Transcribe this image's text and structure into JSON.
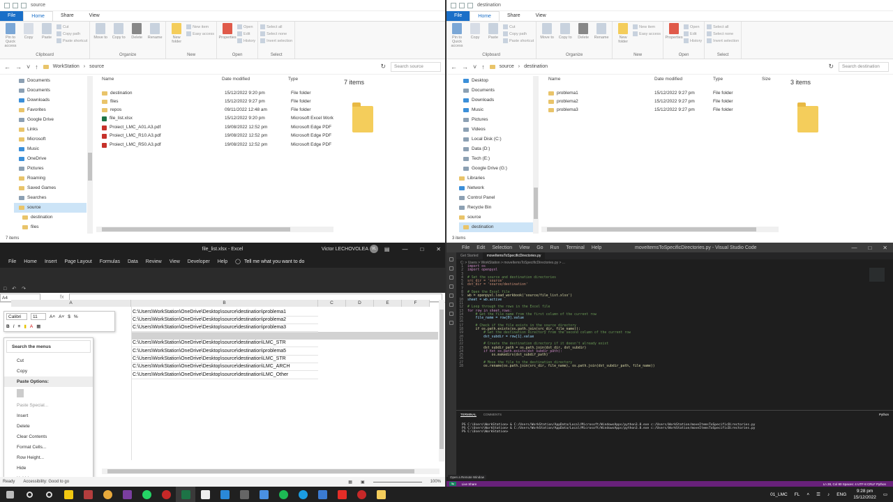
{
  "left_explorer": {
    "title": "source",
    "tabs": [
      "File",
      "Home",
      "Share",
      "View"
    ],
    "ribbon": {
      "clipboard": {
        "pin": "Pin to Quick access",
        "copy": "Copy",
        "paste": "Paste",
        "cut": "Cut",
        "copy_path": "Copy path",
        "paste_shortcut": "Paste shortcut",
        "label": "Clipboard"
      },
      "organize": {
        "move_to": "Move to",
        "copy_to": "Copy to",
        "delete": "Delete",
        "rename": "Rename",
        "label": "Organize"
      },
      "new": {
        "new_folder": "New folder",
        "new_item": "New item",
        "easy_access": "Easy access",
        "label": "New"
      },
      "open": {
        "properties": "Properties",
        "open": "Open",
        "edit": "Edit",
        "history": "History",
        "label": "Open"
      },
      "select": {
        "select_all": "Select all",
        "select_none": "Select none",
        "invert": "Invert selection",
        "label": "Select"
      }
    },
    "path": [
      "WorkStation",
      "source"
    ],
    "search_placeholder": "Search source",
    "nav_items": [
      "Documents",
      "Documents",
      "Downloads",
      "Favorites",
      "Google Drive",
      "Links",
      "Microsoft",
      "Music",
      "OneDrive",
      "Pictures",
      "Roaming",
      "Saved Games",
      "Searches",
      "source",
      "destination",
      "files"
    ],
    "columns": {
      "name": "Name",
      "date": "Date modified",
      "type": "Type"
    },
    "files": [
      {
        "name": "destination",
        "date": "15/12/2022 9:20 pm",
        "type": "File folder",
        "icon": "folder"
      },
      {
        "name": "files",
        "date": "15/12/2022 9:27 pm",
        "type": "File folder",
        "icon": "folder"
      },
      {
        "name": "repos",
        "date": "09/11/2022 12:48 am",
        "type": "File folder",
        "icon": "folder"
      },
      {
        "name": "file_list.xlsx",
        "date": "15/12/2022 9:20 pm",
        "type": "Microsoft Excel Work",
        "icon": "excel"
      },
      {
        "name": "Proiect_LMC_A01.A3.pdf",
        "date": "19/08/2022 12:52 pm",
        "type": "Microsoft Edge PDF",
        "icon": "pdf"
      },
      {
        "name": "Proiect_LMC_R10.A3.pdf",
        "date": "19/08/2022 12:52 pm",
        "type": "Microsoft Edge PDF",
        "icon": "pdf"
      },
      {
        "name": "Proiect_LMC_R50.A3.pdf",
        "date": "19/08/2022 12:52 pm",
        "type": "Microsoft Edge PDF",
        "icon": "pdf"
      }
    ],
    "preview_count": "7 items",
    "status": "7 items"
  },
  "right_explorer": {
    "title": "destination",
    "tabs": [
      "File",
      "Home",
      "Share",
      "View"
    ],
    "ribbon": {
      "clipboard": {
        "pin": "Pin to Quick access",
        "copy": "Copy",
        "paste": "Paste",
        "cut": "Cut",
        "copy_path": "Copy path",
        "paste_shortcut": "Paste shortcut",
        "label": "Clipboard"
      },
      "organize": {
        "move_to": "Move to",
        "copy_to": "Copy to",
        "delete": "Delete",
        "rename": "Rename",
        "label": "Organize"
      },
      "new": {
        "new_folder": "New folder",
        "new_item": "New item",
        "easy_access": "Easy access",
        "label": "New"
      },
      "open": {
        "properties": "Properties",
        "open": "Open",
        "edit": "Edit",
        "history": "History",
        "label": "Open"
      },
      "select": {
        "select_all": "Select all",
        "select_none": "Select none",
        "invert": "Invert selection",
        "label": "Select"
      }
    },
    "path": [
      "source",
      "destination"
    ],
    "search_placeholder": "Search destination",
    "nav_items": [
      "Desktop",
      "Documents",
      "Downloads",
      "Music",
      "Pictures",
      "Videos",
      "Local Disk (C:)",
      "Data (D:)",
      "Tech (E:)",
      "Google Drive (G:)",
      "Libraries",
      "Network",
      "Control Panel",
      "Recycle Bin",
      "source",
      "destination"
    ],
    "columns": {
      "name": "Name",
      "date": "Date modified",
      "type": "Type",
      "size": "Size"
    },
    "files": [
      {
        "name": "problema1",
        "date": "15/12/2022 9:27 pm",
        "type": "File folder"
      },
      {
        "name": "problema2",
        "date": "15/12/2022 9:27 pm",
        "type": "File folder"
      },
      {
        "name": "problema3",
        "date": "15/12/2022 9:27 pm",
        "type": "File folder"
      }
    ],
    "preview_count": "3 items",
    "status": "3 items"
  },
  "excel": {
    "title": "file_list.xlsx  -  Excel",
    "user": "Victor LECHOVOLEA",
    "user_initials": "VL",
    "menu": [
      "File",
      "Home",
      "Insert",
      "Page Layout",
      "Formulas",
      "Data",
      "Review",
      "View",
      "Developer",
      "Help"
    ],
    "tell_me": "Tell me what you want to do",
    "name_box": "A4",
    "fx": "fx",
    "columns": [
      "A",
      "B",
      "C",
      "D",
      "E",
      "F"
    ],
    "col_b_values": [
      "C:\\Users\\WorkStation\\OneDrive\\Desktop\\source\\destination\\problema1",
      "C:\\Users\\WorkStation\\OneDrive\\Desktop\\source\\destination\\problema2",
      "C:\\Users\\WorkStation\\OneDrive\\Desktop\\source\\destination\\problema3",
      "",
      "C:\\Users\\WorkStation\\OneDrive\\Desktop\\source\\destination\\LMC_STR",
      "C:\\Users\\WorkStation\\OneDrive\\Desktop\\source\\destination\\problema5",
      "C:\\Users\\WorkStation\\OneDrive\\Desktop\\source\\destination\\LMC_STR",
      "C:\\Users\\WorkStation\\OneDrive\\Desktop\\source\\destination\\LMC_ARCH",
      "C:\\Users\\WorkStation\\OneDrive\\Desktop\\source\\destination\\LMC_Other"
    ],
    "mini_toolbar": {
      "font": "Calibri",
      "size": "11"
    },
    "context_menu": {
      "search": "Search the menus",
      "items": [
        "Cut",
        "Copy",
        "Paste Options:",
        "",
        "Paste Special...",
        "Insert",
        "Delete",
        "Clear Contents",
        "Format Cells...",
        "Row Height...",
        "Hide",
        "Unhide"
      ]
    },
    "status": {
      "ready": "Ready",
      "accessibility": "Accessibility: Good to go",
      "zoom": "100%"
    }
  },
  "vscode": {
    "menu": [
      "File",
      "Edit",
      "Selection",
      "View",
      "Go",
      "Run",
      "Terminal",
      "Help"
    ],
    "title": "moveItemsToSpecificDirectories.py - Visual Studio Code",
    "tabs": [
      "Get Started",
      "moveItemsToSpecificDirectories.py"
    ],
    "breadcrumb": "C: > Users > WorkStation > moveItemsToSpecificDirectories.py > ...",
    "code": [
      "import os",
      "import openpyxl",
      "",
      "# Set the source and destination directories",
      "src_dir = 'source'",
      "dst_dir = 'source/destination'",
      "",
      "# Open the Excel file",
      "wb = openpyxl.load_workbook('source/file_list.xlsx')",
      "sheet = wb.active",
      "",
      "# Loop through the rows in the Excel file",
      "for row in sheet.rows:",
      "    # Get the file name from the first column of the current row",
      "    file_name = row[0].value",
      "",
      "    # Check if the file exists in the source directory",
      "    if os.path.exists(os.path.join(src_dir, file_name)):",
      "        # Get the destination directory from the second column of the current row",
      "        dst_subdir = row[1].value",
      "",
      "        # Create the destination directory if it doesn't already exist",
      "        dst_subdir_path = os.path.join(dst_dir, dst_subdir)",
      "        if not os.path.exists(dst_subdir_path):",
      "            os.makedirs(dst_subdir_path)",
      "",
      "        # Move the file to the destination directory",
      "        os.rename(os.path.join(src_dir, file_name), os.path.join(dst_subdir_path, file_name))"
    ],
    "terminal_tabs": [
      "TERMINAL",
      "COMMENTS"
    ],
    "terminal_shell": "Python",
    "terminal_lines": [
      "PS C:\\Users\\WorkStation> & C:/Users/WorkStation/AppData/Local/Microsoft/WindowsApps/python3.8.exe c:/Users/WorkStation/moveItemsToSpecificDirectories.py",
      "PS C:\\Users\\WorkStation> & C:/Users/WorkStation/AppData/Local/Microsoft/WindowsApps/python3.8.exe c:/Users/WorkStation/moveItemsToSpecificDirectories.py",
      "PS C:\\Users\\WorkStation>"
    ],
    "remote": "Open a Remote Window",
    "status_left": "Live Share",
    "status_right": "Ln 28, Col 80   Spaces: 4   UTF-8   CRLF   Python"
  },
  "taskbar": {
    "tray_label": "01_LMC",
    "lang": "ENG",
    "lang_sub": "FL",
    "time": "9:28 pm",
    "date": "15/12/2022"
  }
}
